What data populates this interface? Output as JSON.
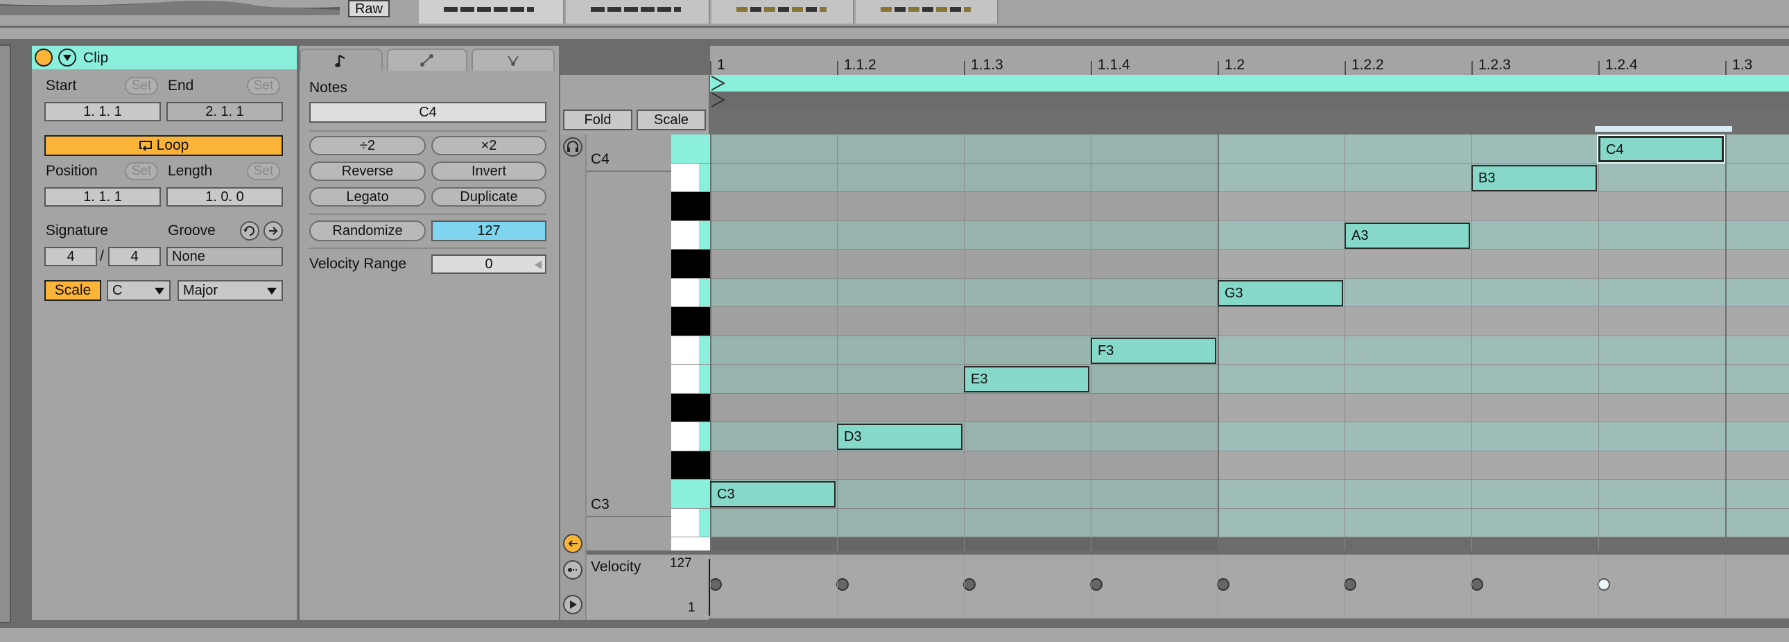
{
  "top": {
    "raw_label": "Raw"
  },
  "clip": {
    "title": "Clip",
    "start_label": "Start",
    "end_label": "End",
    "set_label": "Set",
    "start_value": "1.  1.  1",
    "end_value": "2.  1.  1",
    "loop_label": "Loop",
    "position_label": "Position",
    "length_label": "Length",
    "position_value": "1.  1.  1",
    "length_value": "1.  0.  0",
    "signature_label": "Signature",
    "groove_label": "Groove",
    "sig_num": "4",
    "sig_slash": "/",
    "sig_den": "4",
    "groove_value": "None",
    "scale_label": "Scale",
    "root_value": "C",
    "mode_value": "Major"
  },
  "notes": {
    "title": "Notes",
    "selected_note": "C4",
    "half_label": "÷2",
    "double_label": "×2",
    "reverse_label": "Reverse",
    "invert_label": "Invert",
    "legato_label": "Legato",
    "duplicate_label": "Duplicate",
    "randomize_label": "Randomize",
    "randomize_value": "127",
    "velocity_range_label": "Velocity Range",
    "velocity_range_value": "0"
  },
  "editor": {
    "fold_label": "Fold",
    "scale_label": "Scale",
    "key_c4": "C4",
    "key_c3": "C3",
    "velocity_label": "Velocity",
    "vel_max": "127",
    "vel_min": "1",
    "ruler": [
      "1",
      "1.1.2",
      "1.1.3",
      "1.1.4",
      "1.2",
      "1.2.2",
      "1.2.3",
      "1.2.4",
      "1.3"
    ],
    "note_labels": [
      "C3",
      "D3",
      "E3",
      "F3",
      "G3",
      "A3",
      "B3",
      "C4"
    ]
  },
  "colors": {
    "accent_mint": "#8af0dc",
    "note_fill": "#86d8c8",
    "orange": "#fbb437",
    "blue_value": "#7fd4ef"
  }
}
